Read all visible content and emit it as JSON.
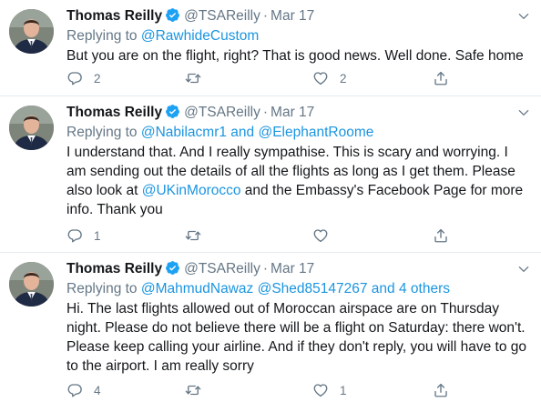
{
  "tweets": [
    {
      "name": "Thomas Reilly",
      "handle": "@TSAReilly",
      "separator": "·",
      "date": "Mar 17",
      "replying_prefix": "Replying to",
      "mentions": [
        "@RawhideCustom"
      ],
      "mention_joiner": "",
      "others": "",
      "text_before": "But you are on the flight, right? That is good news. Well done. Safe home",
      "text_mention": "",
      "text_after": "",
      "reply_count": "2",
      "retweet_count": "",
      "like_count": "2"
    },
    {
      "name": "Thomas Reilly",
      "handle": "@TSAReilly",
      "separator": "·",
      "date": "Mar 17",
      "replying_prefix": "Replying to",
      "mentions": [
        "@Nabilacmr1",
        "@ElephantRoome"
      ],
      "mention_joiner": " and ",
      "others": "",
      "text_before": "I understand that. And I really sympathise. This is scary and worrying. I am sending out the details of all the flights as long as I get them. Please also look at ",
      "text_mention": "@UKinMorocco",
      "text_after": " and the Embassy's Facebook Page for more info. Thank you",
      "reply_count": "1",
      "retweet_count": "",
      "like_count": ""
    },
    {
      "name": "Thomas Reilly",
      "handle": "@TSAReilly",
      "separator": "·",
      "date": "Mar 17",
      "replying_prefix": "Replying to",
      "mentions": [
        "@MahmudNawaz",
        "@Shed85147267"
      ],
      "mention_joiner": " ",
      "others": " and 4 others",
      "text_before": "Hi. The last flights allowed out of Moroccan airspace are on Thursday night. Please do not believe there will be a flight on Saturday: there won't. Please keep calling your airline. And if they don't reply, you will have to go to the airport. I am really sorry",
      "text_mention": "",
      "text_after": "",
      "reply_count": "4",
      "retweet_count": "",
      "like_count": "1"
    }
  ],
  "icons": {
    "verified": "verified-badge-icon",
    "caret": "chevron-down-icon",
    "reply": "reply-icon",
    "retweet": "retweet-icon",
    "like": "heart-icon",
    "share": "share-icon"
  },
  "colors": {
    "link": "#1b95e0",
    "muted": "#657786",
    "text": "#14171a",
    "divider": "#e6ecf0",
    "verified": "#1da1f2"
  }
}
